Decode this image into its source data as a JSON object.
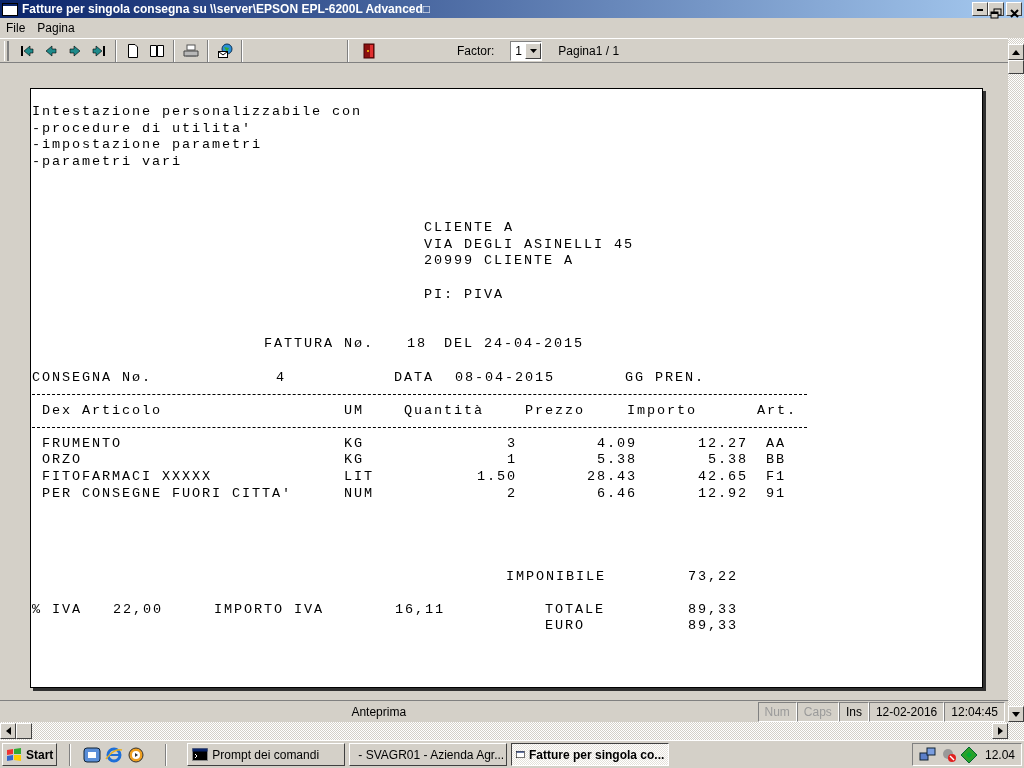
{
  "window": {
    "title": "Fatture per singola consegna su \\\\server\\EPSON EPL-6200L Advanced□"
  },
  "menu": [
    "File",
    "Pagina"
  ],
  "toolbar": {
    "factor_label": "Factor:",
    "factor_value": "1",
    "page_indicator": "Pagina1 / 1"
  },
  "document": {
    "header_lines": [
      "Intestazione personalizzabile con",
      "-procedure di utilita'",
      "-impostazione parametri",
      "-parametri vari"
    ],
    "customer": [
      "CLIENTE A",
      "VIA DEGLI ASINELLI 45",
      "20999 CLIENTE A",
      "PI: PIVA"
    ],
    "invoice": {
      "label": "FATTURA Nø.",
      "number": "18",
      "date": "DEL 24-04-2015"
    },
    "delivery": {
      "label": "CONSEGNA Nø.",
      "number": "4",
      "date_label": "DATA",
      "date": "08-04-2015",
      "note": "GG PREN."
    },
    "columns": [
      "Dex Articolo",
      "UM",
      "Quantità",
      "Prezzo",
      "Importo",
      "Art."
    ],
    "items": [
      {
        "description": "FRUMENTO",
        "unit": "KG",
        "quantity": "3",
        "price": "4.09",
        "amount": "12.27",
        "code": "AA"
      },
      {
        "description": "ORZO",
        "unit": "KG",
        "quantity": "1",
        "price": "5.38",
        "amount": "5.38",
        "code": "BB"
      },
      {
        "description": "FITOFARMACI XXXXX",
        "unit": "LIT",
        "quantity": "1.50",
        "price": "28.43",
        "amount": "42.65",
        "code": "F1"
      },
      {
        "description": "PER CONSEGNE FUORI CITTA'",
        "unit": "NUM",
        "quantity": "2",
        "price": "6.46",
        "amount": "12.92",
        "code": "91"
      }
    ],
    "totals": {
      "taxable_label": "IMPONIBILE",
      "taxable": "73,22",
      "vat_label": "% IVA",
      "vat_rate": "22,00",
      "vat_amount_label": "IMPORTO IVA",
      "vat_amount": "16,11",
      "total_label": "TOTALE",
      "total": "89,33",
      "euro_label": "EURO",
      "euro_total": "89,33"
    }
  },
  "status_bar": {
    "mode": "Anteprima",
    "indicators": [
      {
        "label": "Num",
        "on": false
      },
      {
        "label": "Caps",
        "on": false
      },
      {
        "label": "Ins",
        "on": true
      }
    ],
    "date": "12-02-2016",
    "time": "12:04:45"
  },
  "taskbar": {
    "start": "Start",
    "tasks": [
      {
        "label": "Prompt dei comandi",
        "kind": "console",
        "selected": false
      },
      {
        "label": "- SVAGR01 - Azienda Agr...",
        "kind": "window",
        "selected": false
      },
      {
        "label": "Fatture per singola co...",
        "kind": "window",
        "selected": true
      }
    ],
    "clock": "12.04"
  }
}
